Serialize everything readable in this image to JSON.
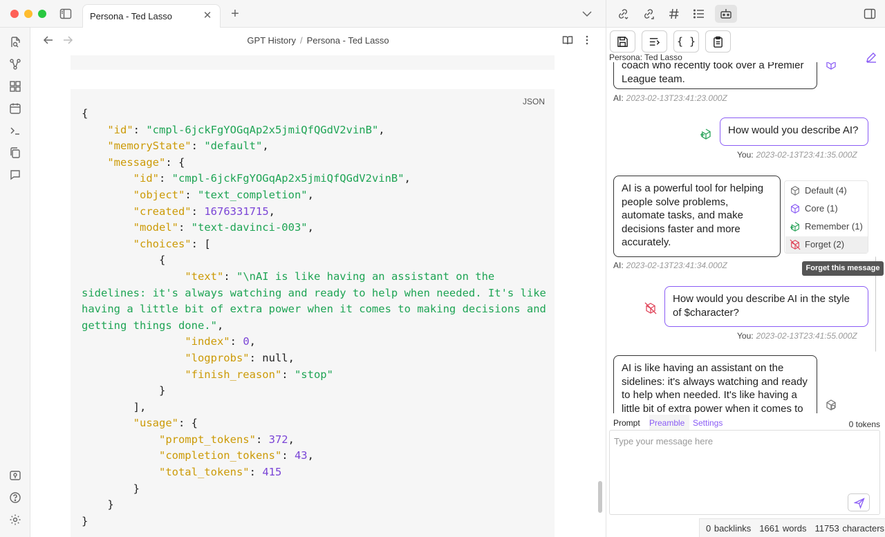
{
  "tab": {
    "title": "Persona - Ted Lasso"
  },
  "breadcrumb": {
    "parent": "GPT History",
    "current": "Persona - Ted Lasso"
  },
  "code_block": {
    "lang": "JSON",
    "lines": [
      [
        [
          "p",
          "{"
        ]
      ],
      [
        [
          "p",
          "    "
        ],
        [
          "k",
          "\"id\""
        ],
        [
          "p",
          ": "
        ],
        [
          "s",
          "\"cmpl-6jckFgYOGqAp2x5jmiQfQGdV2vinB\""
        ],
        [
          "p",
          ","
        ]
      ],
      [
        [
          "p",
          "    "
        ],
        [
          "k",
          "\"memoryState\""
        ],
        [
          "p",
          ": "
        ],
        [
          "s",
          "\"default\""
        ],
        [
          "p",
          ","
        ]
      ],
      [
        [
          "p",
          "    "
        ],
        [
          "k",
          "\"message\""
        ],
        [
          "p",
          ": {"
        ]
      ],
      [
        [
          "p",
          "        "
        ],
        [
          "k",
          "\"id\""
        ],
        [
          "p",
          ": "
        ],
        [
          "s",
          "\"cmpl-6jckFgYOGqAp2x5jmiQfQGdV2vinB\""
        ],
        [
          "p",
          ","
        ]
      ],
      [
        [
          "p",
          "        "
        ],
        [
          "k",
          "\"object\""
        ],
        [
          "p",
          ": "
        ],
        [
          "s",
          "\"text_completion\""
        ],
        [
          "p",
          ","
        ]
      ],
      [
        [
          "p",
          "        "
        ],
        [
          "k",
          "\"created\""
        ],
        [
          "p",
          ": "
        ],
        [
          "n",
          "1676331715"
        ],
        [
          "p",
          ","
        ]
      ],
      [
        [
          "p",
          "        "
        ],
        [
          "k",
          "\"model\""
        ],
        [
          "p",
          ": "
        ],
        [
          "s",
          "\"text-davinci-003\""
        ],
        [
          "p",
          ","
        ]
      ],
      [
        [
          "p",
          "        "
        ],
        [
          "k",
          "\"choices\""
        ],
        [
          "p",
          ": ["
        ]
      ],
      [
        [
          "p",
          "            {"
        ]
      ],
      [
        [
          "p",
          "                "
        ],
        [
          "k",
          "\"text\""
        ],
        [
          "p",
          ": "
        ],
        [
          "s",
          "\"\\nAI is like having an assistant on the sidelines: it's always watching and ready to help when needed. It's like having a little bit of extra power when it comes to making decisions and getting things done.\""
        ],
        [
          "p",
          ","
        ]
      ],
      [
        [
          "p",
          "                "
        ],
        [
          "k",
          "\"index\""
        ],
        [
          "p",
          ": "
        ],
        [
          "n",
          "0"
        ],
        [
          "p",
          ","
        ]
      ],
      [
        [
          "p",
          "                "
        ],
        [
          "k",
          "\"logprobs\""
        ],
        [
          "p",
          ": null,"
        ]
      ],
      [
        [
          "p",
          "                "
        ],
        [
          "k",
          "\"finish_reason\""
        ],
        [
          "p",
          ": "
        ],
        [
          "s",
          "\"stop\""
        ]
      ],
      [
        [
          "p",
          "            }"
        ]
      ],
      [
        [
          "p",
          "        ],"
        ]
      ],
      [
        [
          "p",
          "        "
        ],
        [
          "k",
          "\"usage\""
        ],
        [
          "p",
          ": {"
        ]
      ],
      [
        [
          "p",
          "            "
        ],
        [
          "k",
          "\"prompt_tokens\""
        ],
        [
          "p",
          ": "
        ],
        [
          "n",
          "372"
        ],
        [
          "p",
          ","
        ]
      ],
      [
        [
          "p",
          "            "
        ],
        [
          "k",
          "\"completion_tokens\""
        ],
        [
          "p",
          ": "
        ],
        [
          "n",
          "43"
        ],
        [
          "p",
          ","
        ]
      ],
      [
        [
          "p",
          "            "
        ],
        [
          "k",
          "\"total_tokens\""
        ],
        [
          "p",
          ": "
        ],
        [
          "n",
          "415"
        ]
      ],
      [
        [
          "p",
          "        }"
        ]
      ],
      [
        [
          "p",
          "    }"
        ]
      ],
      [
        [
          "p",
          "}"
        ]
      ]
    ]
  },
  "right_pane": {
    "toolbar": {
      "save": "save-icon",
      "append": "append-icon",
      "json_label": "{ }",
      "clipboard": "clipboard-icon"
    },
    "persona_title": "Persona: Ted Lasso",
    "messages": [
      {
        "text": "coach who recently took over a Premier League team.",
        "meta_label": "AI:",
        "timestamp": "2023-02-13T23:41:23.000Z"
      },
      {
        "text": "How would you describe AI?",
        "meta_label": "You:",
        "timestamp": "2023-02-13T23:41:35.000Z"
      },
      {
        "text": "AI is a powerful tool for helping people solve problems, automate tasks, and make decisions faster and more accurately.",
        "meta_label": "AI:",
        "timestamp": "2023-02-13T23:41:34.000Z"
      },
      {
        "text": "How would you describe AI in the style of $character?",
        "meta_label": "You:",
        "timestamp": "2023-02-13T23:41:55.000Z"
      },
      {
        "text": "AI is like having an assistant on the sidelines: it's always watching and ready to help when needed. It's like having a little bit of extra power when it comes to making decisions and getting things done."
      }
    ],
    "memory_menu": [
      {
        "label": "Default (4)",
        "color": "#777777"
      },
      {
        "label": "Core (1)",
        "color": "#8a5cf5"
      },
      {
        "label": "Remember (1)",
        "color": "#2aa35a"
      },
      {
        "label": "Forget (2)",
        "color": "#e0455a"
      }
    ],
    "tooltip": "Forget this message",
    "prompt_tabs": {
      "prompt": "Prompt",
      "preamble": "Preamble",
      "settings": "Settings"
    },
    "tokens": "0 tokens",
    "placeholder": "Type your message here"
  },
  "status_bar": {
    "backlinks": "0 backlinks",
    "words": "1661 words",
    "characters": "11753 characters"
  },
  "colors": {
    "accent": "#8a5cf5",
    "remember": "#2aa35a",
    "forget": "#e0455a",
    "json_key": "#cc9a06",
    "json_string": "#1ea454",
    "json_number": "#7a44d6"
  }
}
